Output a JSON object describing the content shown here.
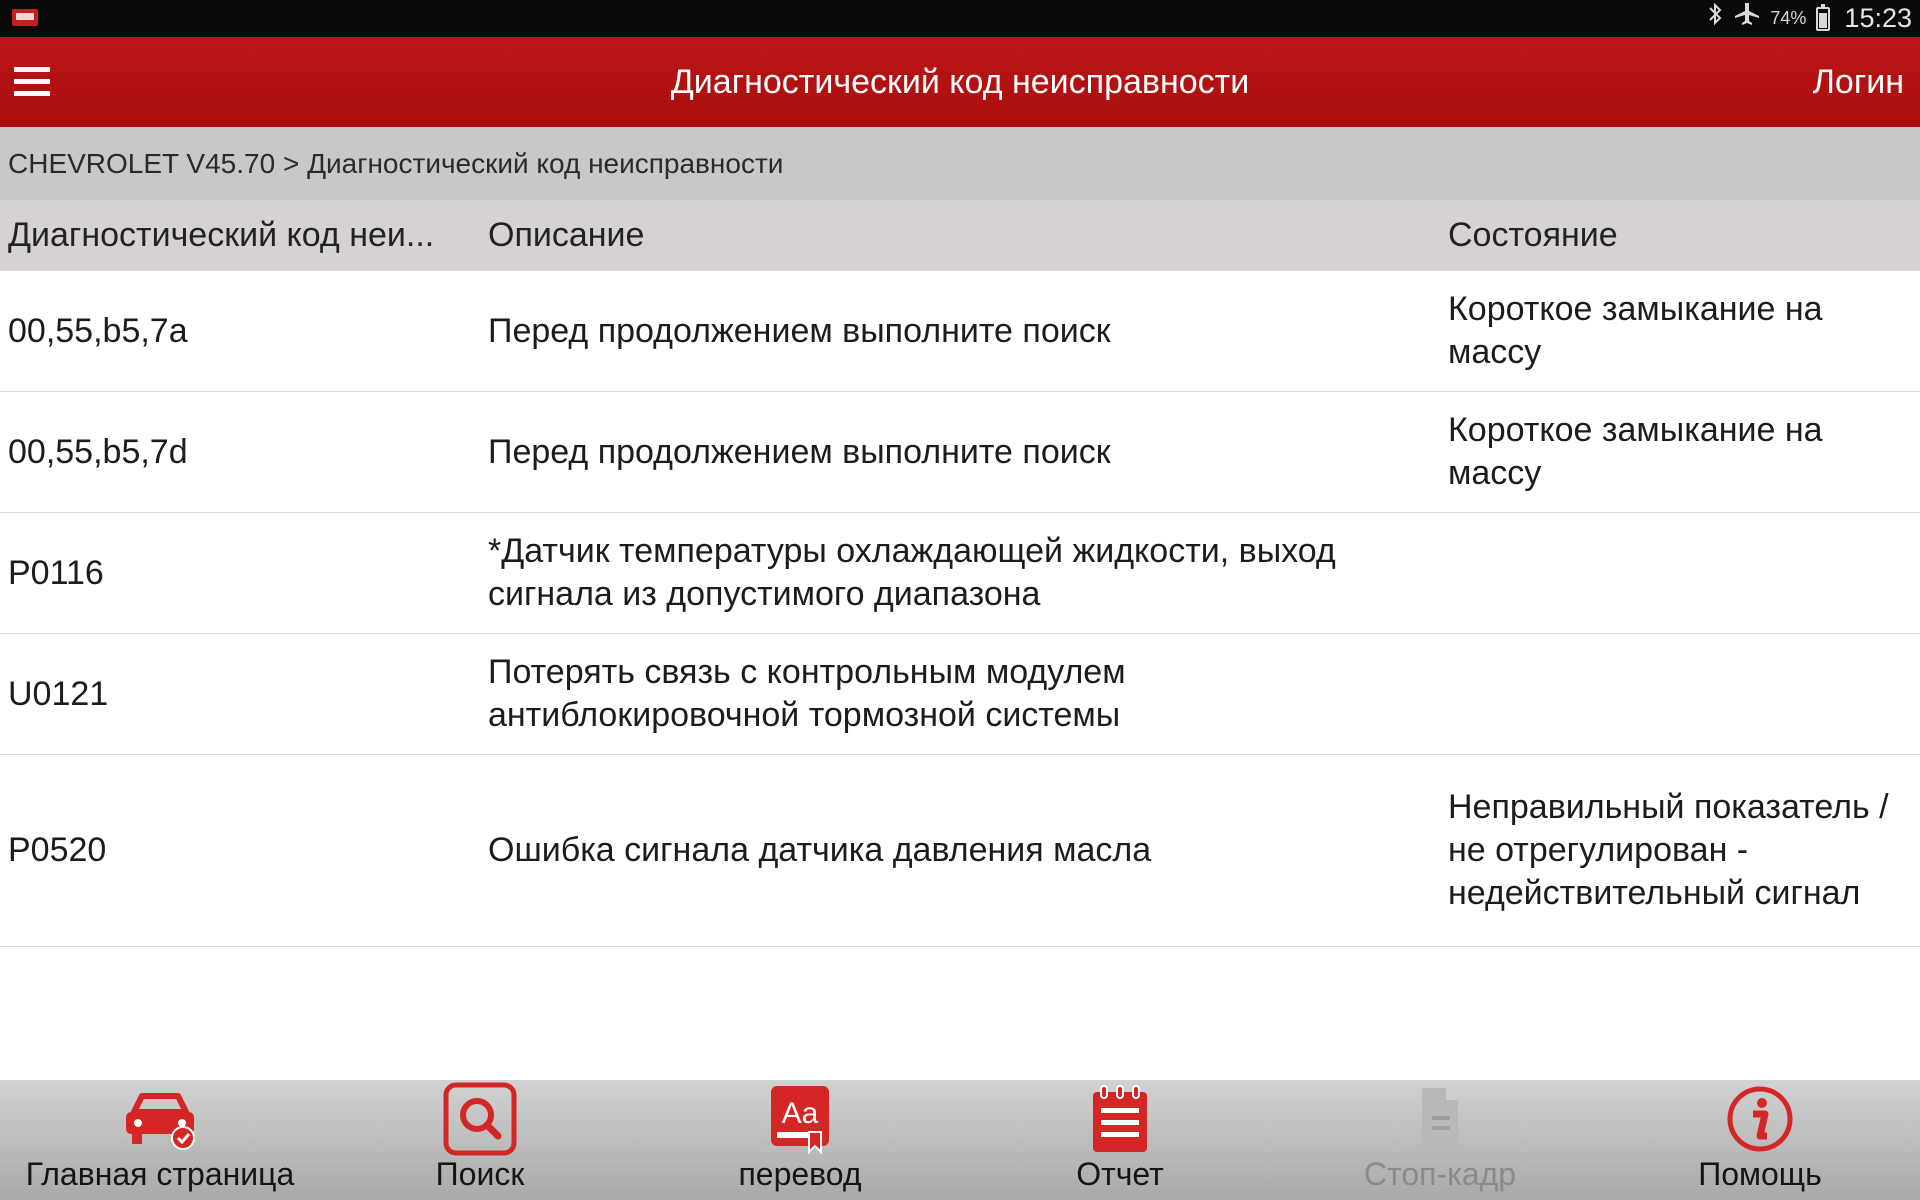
{
  "status_bar": {
    "battery_percent": "74%",
    "battery_level": 0.74,
    "time": "15:23",
    "icons": [
      "app-logo-icon",
      "bluetooth-icon",
      "airplane-mode-icon",
      "battery-icon"
    ]
  },
  "header": {
    "title": "Диагностический код неисправности",
    "login_label": "Логин",
    "menu_icon": "hamburger-menu-icon",
    "accent_color": "#b31212"
  },
  "breadcrumb": "CHEVROLET V45.70 > Диагностический код неисправности",
  "table": {
    "columns": [
      "Диагностический код неи...",
      "Описание",
      "Состояние"
    ],
    "rows": [
      {
        "code": "00,55,b5,7a",
        "description": "Перед продолжением выполните поиск",
        "status": "Короткое замыкание на массу"
      },
      {
        "code": "00,55,b5,7d",
        "description": "Перед продолжением выполните поиск",
        "status": "Короткое замыкание на массу"
      },
      {
        "code": "P0116",
        "description": "*Датчик температуры охлаждающей жидкости, выход сигнала из допустимого диапазона",
        "status": ""
      },
      {
        "code": "U0121",
        "description": "Потерять связь с контрольным модулем антиблокировочной тормозной системы",
        "status": ""
      },
      {
        "code": "P0520",
        "description": "Ошибка сигнала датчика давления масла",
        "status": "Неправильный показатель / не отрегулирован - недействительный сигнал"
      }
    ]
  },
  "bottom_nav": [
    {
      "label": "Главная страница",
      "icon": "car-check-icon",
      "enabled": true
    },
    {
      "label": "Поиск",
      "icon": "search-icon",
      "enabled": true
    },
    {
      "label": "перевод",
      "icon": "translate-icon",
      "enabled": true
    },
    {
      "label": "Отчет",
      "icon": "report-icon",
      "enabled": true
    },
    {
      "label": "Стоп-кадр",
      "icon": "freeze-frame-icon",
      "enabled": false
    },
    {
      "label": "Помощь",
      "icon": "help-info-icon",
      "enabled": true
    }
  ]
}
